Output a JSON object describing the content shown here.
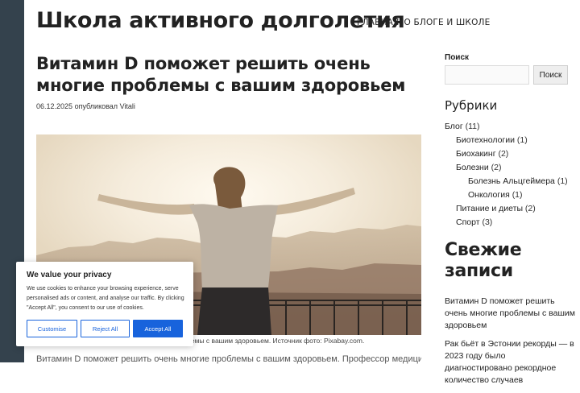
{
  "site": {
    "title": "Школа активного долголетия",
    "nav": [
      {
        "label": "ГЛАВНАЯ"
      },
      {
        "label": "О БЛОГЕ И ШКОЛЕ"
      }
    ]
  },
  "article": {
    "title": "Витамин D поможет решить очень многие проблемы с вашим здоровьем",
    "date": "06.12.2025",
    "published_by": "опубликовал",
    "author": "Vitali",
    "image_caption": "Витамин D поможет решить очень многие проблемы с вашим здоровьем. Источник фото: Pixabay.com.",
    "body_start": "Витамин D поможет решить очень многие проблемы с вашим здоровьем. Профессор медицинской"
  },
  "sidebar": {
    "search_label": "Поиск",
    "search_value": "",
    "search_button": "Поиск",
    "categories_title": "Рубрики",
    "categories": [
      {
        "name": "Блог",
        "count": "(11)",
        "level": 0
      },
      {
        "name": "Биотехнологии",
        "count": "(1)",
        "level": 1
      },
      {
        "name": "Биохакинг",
        "count": "(2)",
        "level": 1
      },
      {
        "name": "Болезни",
        "count": "(2)",
        "level": 1
      },
      {
        "name": "Болезнь Альцгеймера",
        "count": "(1)",
        "level": 2
      },
      {
        "name": "Онкология",
        "count": "(1)",
        "level": 2
      },
      {
        "name": "Питание и диеты",
        "count": "(2)",
        "level": 1
      },
      {
        "name": "Спорт",
        "count": "(3)",
        "level": 1
      }
    ],
    "recent_title": "Свежие записи",
    "recent_posts": [
      {
        "title": "Витамин D поможет решить очень многие проблемы с вашим здоровьем"
      },
      {
        "title": "Рак бьёт в Эстонии рекорды — в 2023 году было диагностировано рекордное количество случаев"
      }
    ]
  },
  "cookie_banner": {
    "title": "We value your privacy",
    "text": "We use cookies to enhance your browsing experience, serve personalised ads or content, and analyse our traffic. By clicking \"Accept All\", you consent to our use of cookies.",
    "customise": "Customise",
    "reject": "Reject All",
    "accept": "Accept All"
  },
  "colors": {
    "sidebar_strip": "#34424d",
    "cookie_accent": "#1863dc"
  }
}
